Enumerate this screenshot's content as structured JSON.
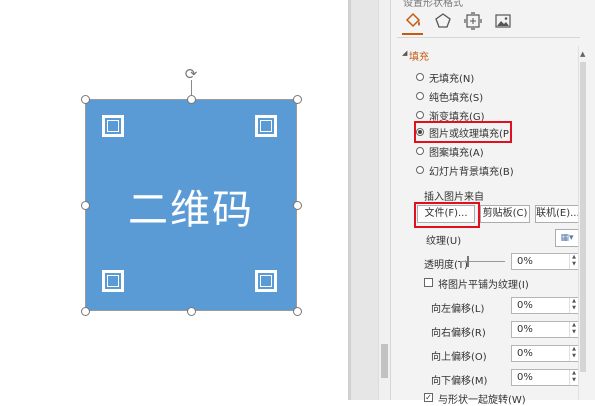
{
  "canvas": {
    "shape_text": "二维码",
    "shape_color": "#5b9bd5"
  },
  "panel": {
    "title": "设置形状格式",
    "accent_color": "#c55a11",
    "tool_icons": [
      "fill-line-icon",
      "effects-icon",
      "size-properties-icon",
      "picture-icon"
    ],
    "section_title": "填充",
    "fill_options": [
      {
        "label": "无填充(N)",
        "selected": false
      },
      {
        "label": "纯色填充(S)",
        "selected": false
      },
      {
        "label": "渐变填充(G)",
        "selected": false
      },
      {
        "label": "图片或纹理填充(P)",
        "selected": true
      },
      {
        "label": "图案填充(A)",
        "selected": false
      },
      {
        "label": "幻灯片背景填充(B)",
        "selected": false
      }
    ],
    "insert_from_label": "插入图片来自",
    "file_button": "文件(F)...",
    "clipboard_button": "剪贴板(C)",
    "online_button": "联机(E)...",
    "texture_label": "纹理(U)",
    "transparency_label": "透明度(T)",
    "transparency_value": "0%",
    "tile_checkbox_label": "将图片平铺为纹理(I)",
    "offsets": [
      {
        "label": "向左偏移(L)",
        "value": "0%"
      },
      {
        "label": "向右偏移(R)",
        "value": "0%"
      },
      {
        "label": "向上偏移(O)",
        "value": "0%"
      },
      {
        "label": "向下偏移(M)",
        "value": "0%"
      }
    ],
    "rotate_checkbox_label": "与形状一起旋转(W)"
  }
}
